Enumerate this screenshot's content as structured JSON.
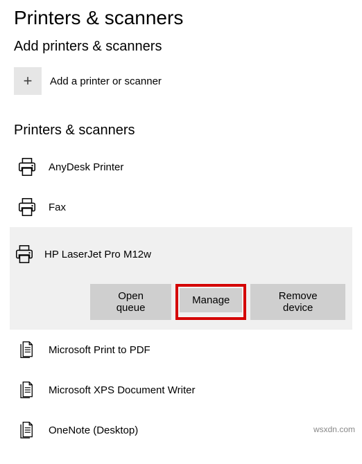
{
  "page_title": "Printers & scanners",
  "add_section": {
    "heading": "Add printers & scanners",
    "button_label": "Add a printer or scanner"
  },
  "list_section": {
    "heading": "Printers & scanners",
    "items": [
      {
        "name": "AnyDesk Printer",
        "icon": "printer"
      },
      {
        "name": "Fax",
        "icon": "printer"
      },
      {
        "name": "HP LaserJet Pro M12w",
        "icon": "printer",
        "selected": true
      },
      {
        "name": "Microsoft Print to PDF",
        "icon": "document"
      },
      {
        "name": "Microsoft XPS Document Writer",
        "icon": "document"
      },
      {
        "name": "OneNote (Desktop)",
        "icon": "document"
      }
    ]
  },
  "actions": {
    "open_queue": "Open queue",
    "manage": "Manage",
    "remove": "Remove device"
  },
  "watermark": "wsxdn.com",
  "colors": {
    "highlight": "#d40000",
    "selected_bg": "#f0f0f0",
    "button_bg": "#cfcfcf"
  }
}
